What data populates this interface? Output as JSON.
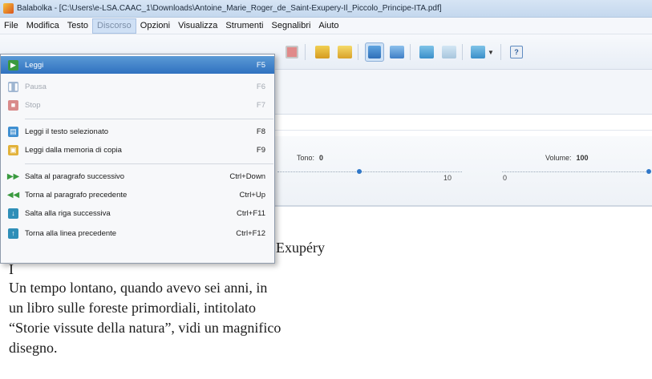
{
  "window": {
    "title": "Balabolka - [C:\\Users\\e-LSA.CAAC_1\\Downloads\\Antoine_Marie_Roger_de_Saint-Exupery-Il_Piccolo_Principe-ITA.pdf]"
  },
  "menubar": [
    {
      "label": "File",
      "active": false
    },
    {
      "label": "Modifica",
      "active": false
    },
    {
      "label": "Testo",
      "active": false
    },
    {
      "label": "Discorso",
      "active": true
    },
    {
      "label": "Opzioni",
      "active": false
    },
    {
      "label": "Visualizza",
      "active": false
    },
    {
      "label": "Strumenti",
      "active": false
    },
    {
      "label": "Segnalibri",
      "active": false
    },
    {
      "label": "Aiuto",
      "active": false
    }
  ],
  "speech_menu": {
    "items": [
      {
        "label": "Leggi",
        "shortcut": "F5",
        "state": "hover",
        "icon": "play-icon",
        "color": "#3a9a3f"
      },
      {
        "label": "Pausa",
        "shortcut": "F6",
        "state": "disabled",
        "icon": "pause-icon",
        "color": "#9fb6d1"
      },
      {
        "label": "Stop",
        "shortcut": "F7",
        "state": "disabled",
        "icon": "stop-icon",
        "color": "#d98b8b"
      },
      {
        "label": "Leggi il testo selezionato",
        "shortcut": "F8",
        "state": "normal",
        "icon": "read-selection-icon",
        "color": "#3f8fd1"
      },
      {
        "label": "Leggi dalla memoria di copia",
        "shortcut": "F9",
        "state": "normal",
        "icon": "clipboard-icon",
        "color": "#e2b23a"
      },
      {
        "label": "Salta al paragrafo successivo",
        "shortcut": "Ctrl+Down",
        "state": "normal",
        "icon": "skip-forward-icon",
        "color": "#3a9a3f"
      },
      {
        "label": "Torna al paragrafo precedente",
        "shortcut": "Ctrl+Up",
        "state": "normal",
        "icon": "skip-back-icon",
        "color": "#3a9a3f"
      },
      {
        "label": "Salta alla riga successiva",
        "shortcut": "Ctrl+F11",
        "state": "normal",
        "icon": "next-line-icon",
        "color": "#2f8fb8"
      },
      {
        "label": "Torna alla linea precedente",
        "shortcut": "Ctrl+F12",
        "state": "normal",
        "icon": "prev-line-icon",
        "color": "#2f8fb8"
      }
    ]
  },
  "sliders": {
    "tono_label": "Tono:",
    "tono_value": "0",
    "volume_label": "Volume:",
    "volume_value": "100",
    "tick_10": "10",
    "tick_0": "0"
  },
  "document": {
    "title_fragment": "Exupéry",
    "lines": [
      "I",
      "Un tempo lontano, quando avevo sei anni, in",
      "un libro sulle foreste primordiali, intitolato",
      "“Storie vissute della natura”, vidi un magnifico",
      "disegno."
    ]
  },
  "colors": {
    "accent": "#2f71bf",
    "menu_hover": "#5b9ad6"
  }
}
